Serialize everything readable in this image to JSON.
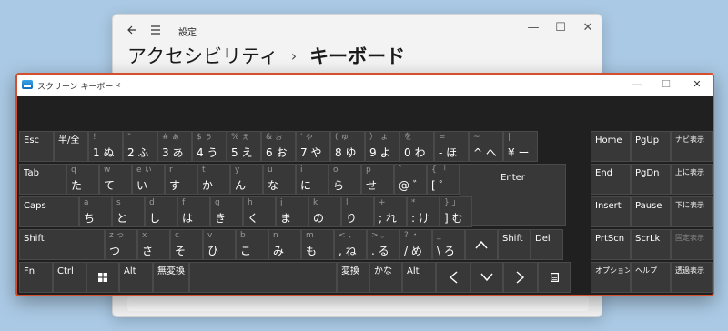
{
  "settings_window": {
    "app_title": "設定",
    "back_icon": "back-arrow-icon",
    "menu_icon": "hamburger-menu-icon",
    "breadcrumb_parent": "アクセシビリティ",
    "breadcrumb_separator": "›",
    "breadcrumb_current": "キーボード"
  },
  "osk": {
    "title": "スクリーン キーボード",
    "accent_border": "#d34f2e",
    "rows": {
      "r1": [
        {
          "l": "Esc"
        },
        {
          "l": "半/全"
        },
        {
          "t": "!",
          "b": "1 ぬ"
        },
        {
          "t": "\"",
          "b": "2 ふ"
        },
        {
          "t": "# ぁ",
          "b": "3 あ"
        },
        {
          "t": "$ ぅ",
          "b": "4 う"
        },
        {
          "t": "% ぇ",
          "b": "5 え"
        },
        {
          "t": "& ぉ",
          "b": "6 お"
        },
        {
          "t": "' ゃ",
          "b": "7 や"
        },
        {
          "t": "( ゅ",
          "b": "8 ゆ"
        },
        {
          "t": "） ょ",
          "b": "9 よ"
        },
        {
          "t": "を",
          "b": "0 わ"
        },
        {
          "t": "=",
          "b": "- ほ"
        },
        {
          "t": "~",
          "b": "^ へ"
        },
        {
          "t": "|",
          "b": "¥ ー"
        }
      ],
      "r2": [
        {
          "l": "Tab"
        },
        {
          "t": "q",
          "b": "た"
        },
        {
          "t": "w",
          "b": "て"
        },
        {
          "t": "e ぃ",
          "b": "い"
        },
        {
          "t": "r",
          "b": "す"
        },
        {
          "t": "t",
          "b": "か"
        },
        {
          "t": "y",
          "b": "ん"
        },
        {
          "t": "u",
          "b": "な"
        },
        {
          "t": "i",
          "b": "に"
        },
        {
          "t": "o",
          "b": "ら"
        },
        {
          "t": "p",
          "b": "せ"
        },
        {
          "t": "`",
          "b": "@ ゛"
        },
        {
          "t": "{ 「",
          "b": "[ ゜"
        },
        {
          "l": "Enter"
        }
      ],
      "r3": [
        {
          "l": "Caps"
        },
        {
          "t": "a",
          "b": "ち"
        },
        {
          "t": "s",
          "b": "と"
        },
        {
          "t": "d",
          "b": "し"
        },
        {
          "t": "f",
          "b": "は"
        },
        {
          "t": "g",
          "b": "き"
        },
        {
          "t": "h",
          "b": "く"
        },
        {
          "t": "j",
          "b": "ま"
        },
        {
          "t": "k",
          "b": "の"
        },
        {
          "t": "l",
          "b": "り"
        },
        {
          "t": "+",
          "b": "; れ"
        },
        {
          "t": "*",
          "b": ": け"
        },
        {
          "t": "} 」",
          "b": "] む"
        }
      ],
      "r4": [
        {
          "l": "Shift"
        },
        {
          "t": "z っ",
          "b": "つ"
        },
        {
          "t": "x",
          "b": "さ"
        },
        {
          "t": "c",
          "b": "そ"
        },
        {
          "t": "v",
          "b": "ひ"
        },
        {
          "t": "b",
          "b": "こ"
        },
        {
          "t": "n",
          "b": "み"
        },
        {
          "t": "m",
          "b": "も"
        },
        {
          "t": "< 、",
          "b": ", ね"
        },
        {
          "t": "> 。",
          "b": ". る"
        },
        {
          "t": "? ・",
          "b": "/ め"
        },
        {
          "t": "_",
          "b": "\\ ろ"
        },
        {
          "l": "↑",
          "icon": "up-arrow-icon"
        },
        {
          "l": "Shift"
        },
        {
          "l": "Del"
        }
      ],
      "r5": [
        {
          "l": "Fn"
        },
        {
          "l": "Ctrl"
        },
        {
          "l": "",
          "icon": "windows-logo-icon"
        },
        {
          "l": "Alt"
        },
        {
          "l": "無変換"
        },
        {
          "l": "",
          "icon": "space"
        },
        {
          "l": "変換"
        },
        {
          "l": "かな"
        },
        {
          "l": "Alt"
        },
        {
          "l": "←",
          "icon": "left-arrow-icon"
        },
        {
          "l": "↓",
          "icon": "down-arrow-icon"
        },
        {
          "l": "→",
          "icon": "right-arrow-icon"
        },
        {
          "l": "",
          "icon": "context-menu-icon"
        }
      ]
    },
    "nav": {
      "c1": [
        "Home",
        "End",
        "Insert",
        "PrtScn",
        "オプション"
      ],
      "c2": [
        "PgUp",
        "PgDn",
        "Pause",
        "ScrLk",
        "ヘルプ"
      ],
      "c3": [
        "ナビ表示",
        "上に表示",
        "下に表示",
        "固定表示",
        "透過表示"
      ]
    }
  }
}
